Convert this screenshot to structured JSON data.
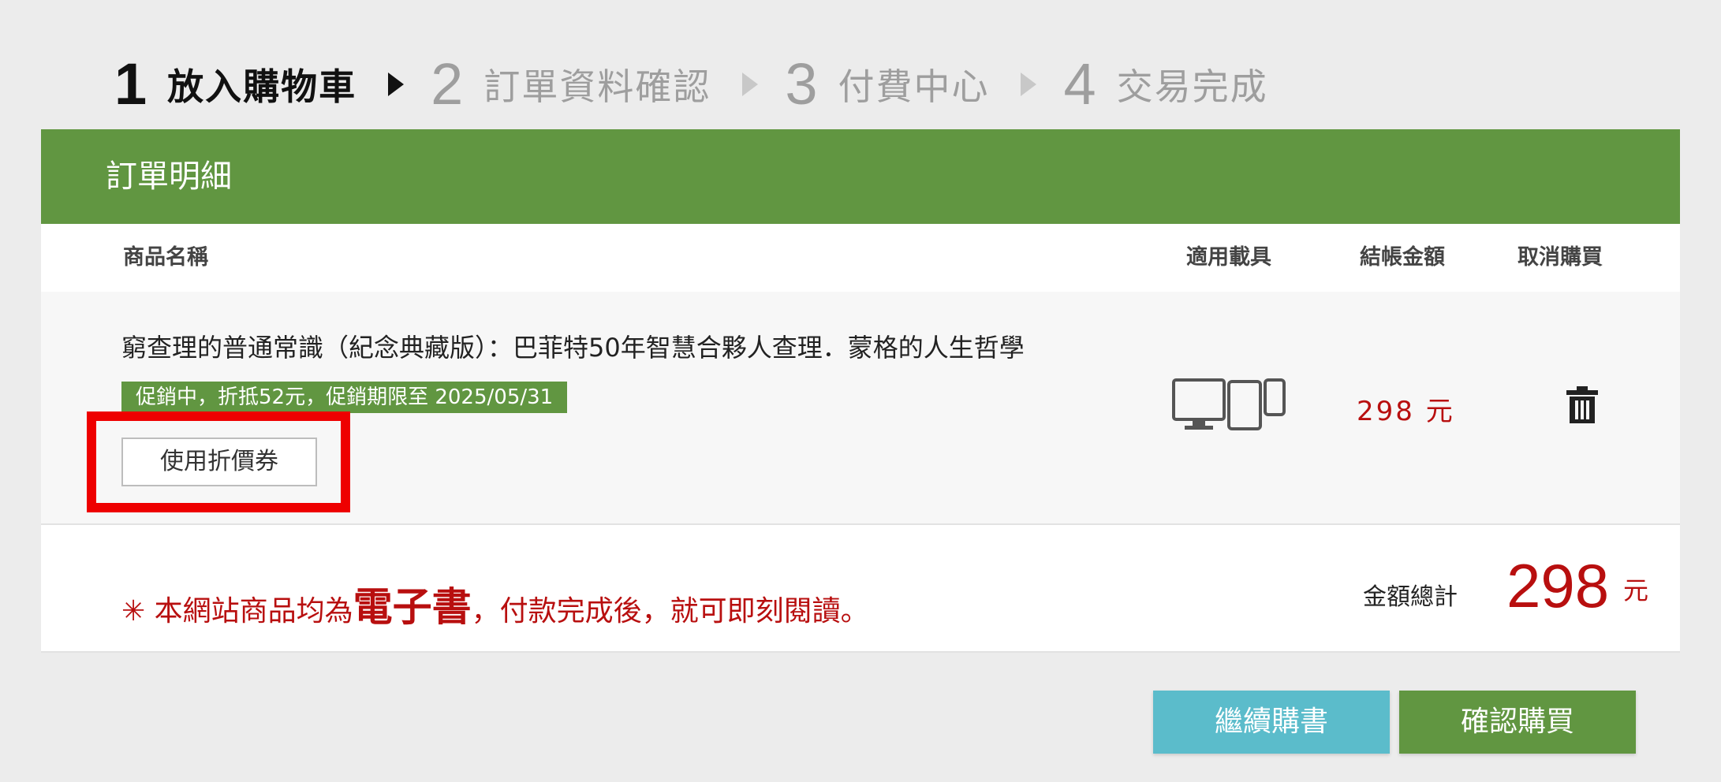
{
  "steps": [
    {
      "num": "1",
      "label": "放入購物車"
    },
    {
      "num": "2",
      "label": "訂單資料確認"
    },
    {
      "num": "3",
      "label": "付費中心"
    },
    {
      "num": "4",
      "label": "交易完成"
    }
  ],
  "order": {
    "header_title": "訂單明細",
    "columns": {
      "name": "商品名稱",
      "devices": "適用載具",
      "amount": "結帳金額",
      "cancel": "取消購買"
    },
    "item": {
      "title": "窮查理的普通常識（紀念典藏版）：巴菲特50年智慧合夥人查理．蒙格的人生哲學",
      "promo": "促銷中，折抵52元，促銷期限至 2025/05/31",
      "coupon_button": "使用折價券",
      "price": "298 元",
      "device_icon": "monitor-tablet-phone-icons",
      "cancel_icon": "trash-icon"
    },
    "notice": {
      "prefix": "✳ 本網站商品均為",
      "emphasis": "電子書",
      "suffix": "，付款完成後，就可即刻閱讀。"
    },
    "total": {
      "label": "金額總計",
      "amount": "298",
      "currency": "元"
    }
  },
  "buttons": {
    "continue": "繼續購書",
    "confirm": "確認購買"
  },
  "colors": {
    "green": "#619641",
    "teal": "#5bbccb",
    "red_price": "#b80f0f",
    "highlight": "#ee0000"
  }
}
